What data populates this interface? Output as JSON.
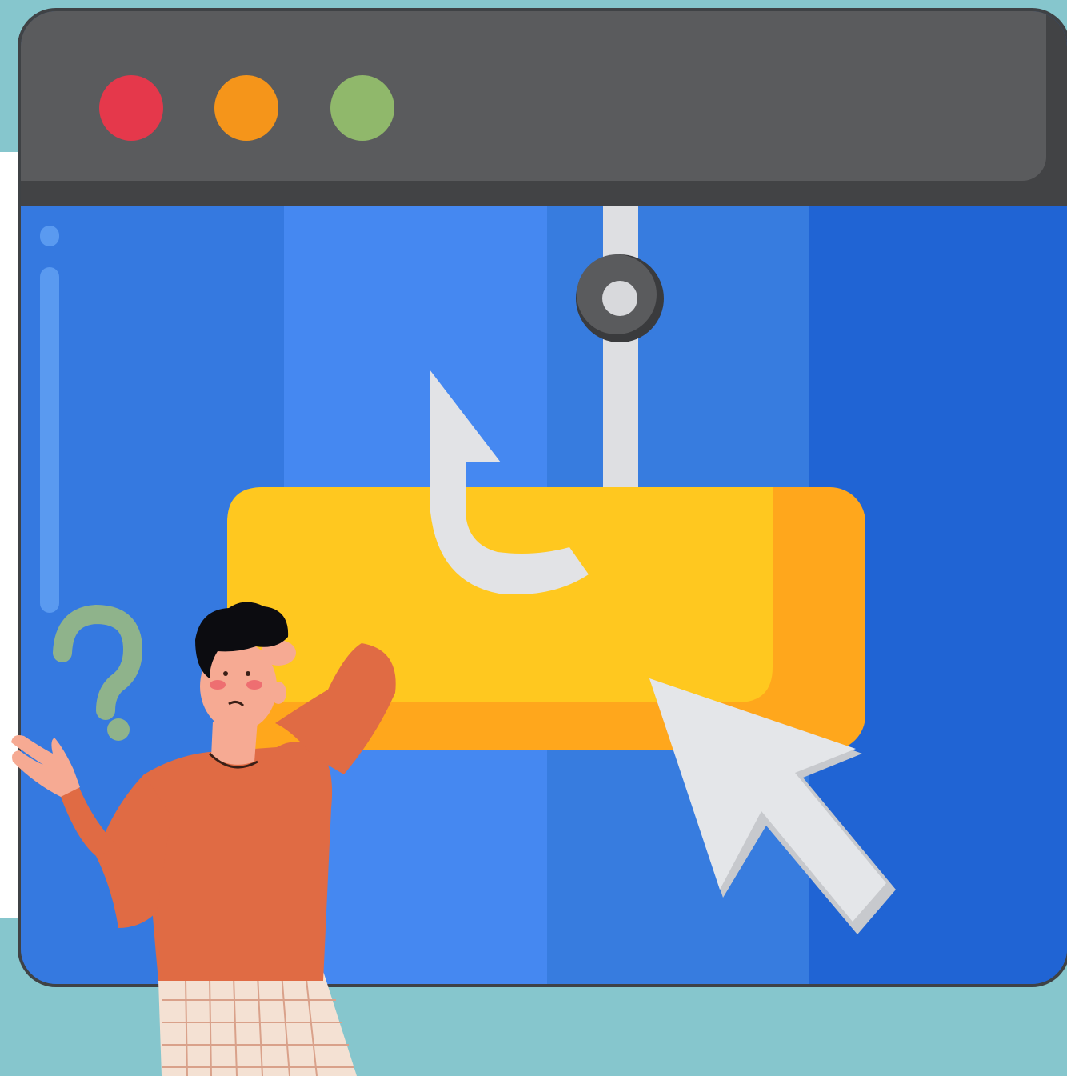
{
  "window": {
    "control_dots": [
      {
        "name": "close",
        "color": "#e5384b"
      },
      {
        "name": "minimize",
        "color": "#f5951a"
      },
      {
        "name": "maximize",
        "color": "#90b86b"
      }
    ]
  },
  "colors": {
    "background": "#86c6cd",
    "titlebar": "#5a5b5d",
    "content_blue": "#3579e0",
    "bait_button": "#ffc81f",
    "bait_button_shadow": "#ffa71c",
    "hook": "#dedfe2",
    "cursor": "#e4e6e9",
    "person_shirt": "#e06b44",
    "question_mark": "#8fb38b"
  },
  "icons": [
    "fishing-hook-icon",
    "mouse-cursor-icon",
    "question-mark-icon"
  ]
}
